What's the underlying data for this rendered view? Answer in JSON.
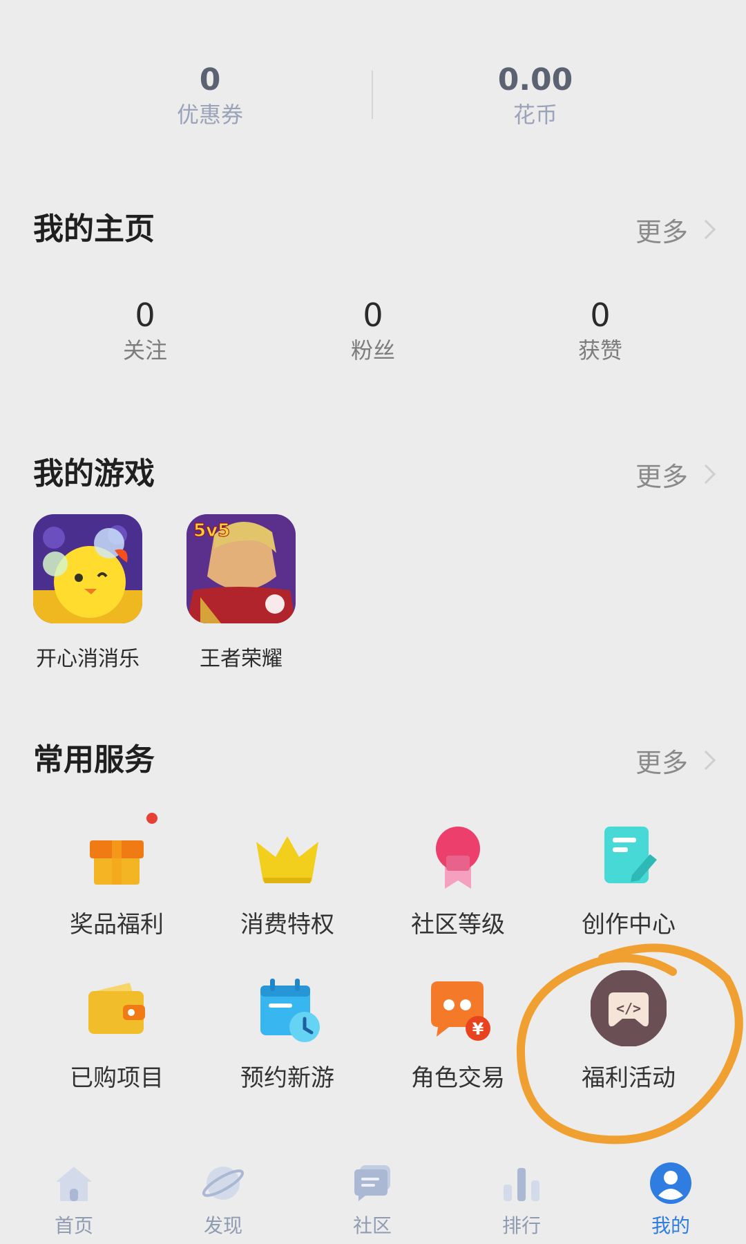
{
  "wallet": {
    "coupons": {
      "value": "0",
      "label": "优惠券"
    },
    "coins": {
      "value": "0.00",
      "label": "花币"
    }
  },
  "homepage": {
    "title": "我的主页",
    "more": "更多",
    "stats": [
      {
        "value": "0",
        "label": "关注"
      },
      {
        "value": "0",
        "label": "粉丝"
      },
      {
        "value": "0",
        "label": "获赞"
      }
    ]
  },
  "games": {
    "title": "我的游戏",
    "more": "更多",
    "items": [
      {
        "name": "开心消消乐",
        "icon": "chick-bubble-game-icon"
      },
      {
        "name": "王者荣耀",
        "icon": "hero-5v5-game-icon"
      }
    ]
  },
  "services": {
    "title": "常用服务",
    "more": "更多",
    "items": [
      {
        "name": "奖品福利",
        "icon": "gift-box-icon",
        "badge": true
      },
      {
        "name": "消费特权",
        "icon": "crown-icon"
      },
      {
        "name": "社区等级",
        "icon": "medal-icon"
      },
      {
        "name": "创作中心",
        "icon": "document-pen-icon"
      },
      {
        "name": "已购项目",
        "icon": "wallet-icon"
      },
      {
        "name": "预约新游",
        "icon": "calendar-clock-icon"
      },
      {
        "name": "角色交易",
        "icon": "chat-yuan-icon"
      },
      {
        "name": "福利活动",
        "icon": "gamepad-code-icon"
      }
    ]
  },
  "tabbar": {
    "items": [
      {
        "label": "首页",
        "icon": "home-icon"
      },
      {
        "label": "发现",
        "icon": "planet-icon"
      },
      {
        "label": "社区",
        "icon": "chat-bubble-icon"
      },
      {
        "label": "排行",
        "icon": "bar-chart-icon"
      },
      {
        "label": "我的",
        "icon": "profile-icon"
      }
    ],
    "active_color": "#2f7de1",
    "inactive_color": "#8f9bb0"
  },
  "annotation": {
    "color": "#f0a030"
  }
}
